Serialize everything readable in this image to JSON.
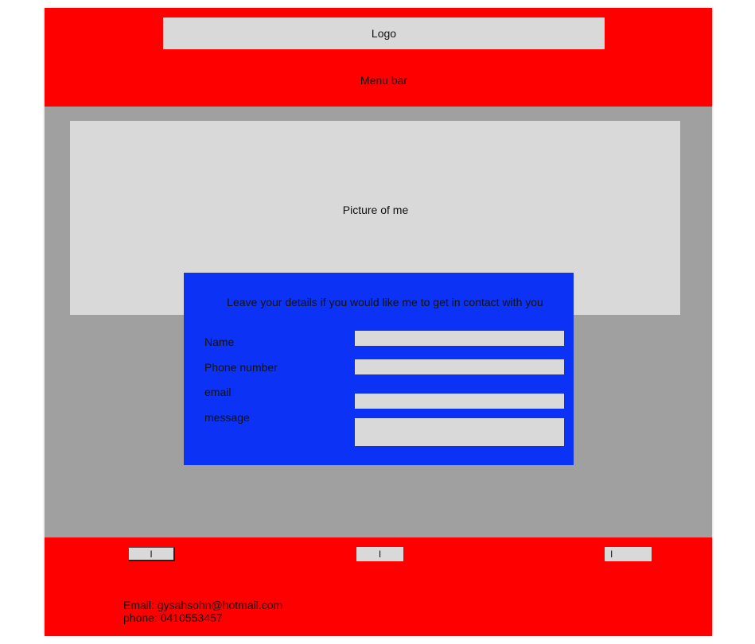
{
  "header": {
    "logo_text": "Logo",
    "menu_text": "Menu bar"
  },
  "main": {
    "picture_text": "Picture of me"
  },
  "contact_form": {
    "title": "Leave your details if you would like me to get in contact with you",
    "fields": [
      {
        "label": "Name",
        "value": ""
      },
      {
        "label": "Phone number",
        "value": ""
      },
      {
        "label": "email",
        "value": ""
      },
      {
        "label": "message",
        "value": ""
      }
    ]
  },
  "footer": {
    "buttons": [
      {
        "label": "I"
      },
      {
        "label": "I"
      },
      {
        "label": "I"
      }
    ],
    "email_line": "Email: gysahsohn@hotmail.com",
    "phone_line": "phone: 0410553457"
  },
  "colors": {
    "header_footer": "#ff0000",
    "content_bg": "#a0a0a0",
    "placeholder_box": "#d9d9d9",
    "form_bg": "#0c33f5"
  }
}
